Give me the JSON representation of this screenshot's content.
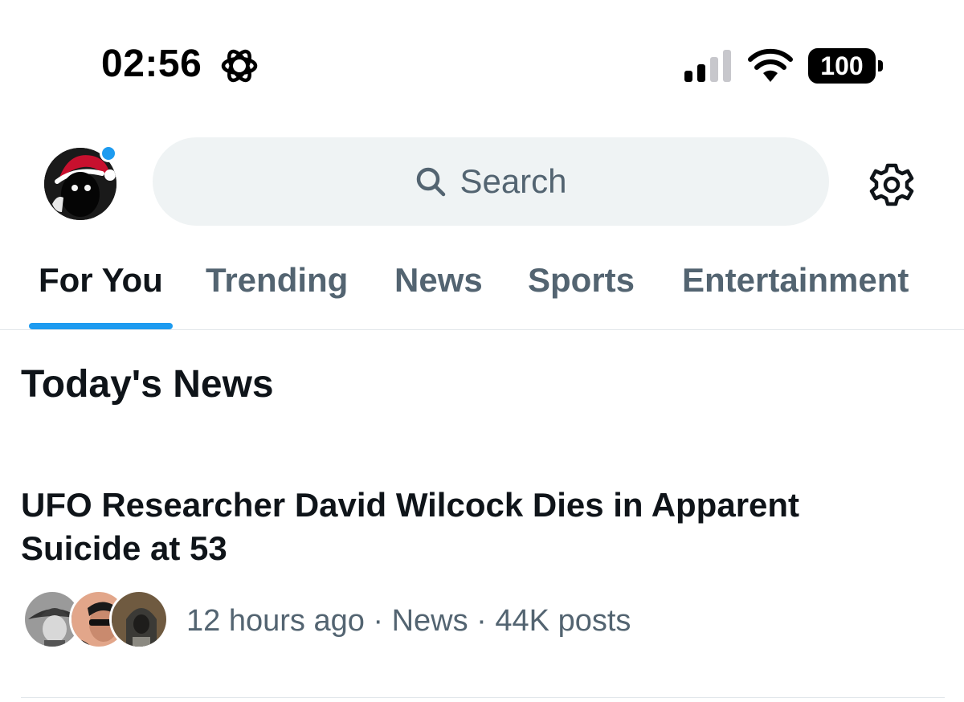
{
  "status_bar": {
    "time": "02:56",
    "status_icon": "gear-icon",
    "signal_icon": "cellular-signal-icon",
    "wifi_icon": "wifi-icon",
    "battery": "100"
  },
  "header": {
    "avatar_icon": "profile-avatar",
    "search_placeholder": "Search",
    "settings_icon": "gear-icon"
  },
  "tabs": [
    {
      "label": "For You",
      "active": true
    },
    {
      "label": "Trending",
      "active": false
    },
    {
      "label": "News",
      "active": false
    },
    {
      "label": "Sports",
      "active": false
    },
    {
      "label": "Entertainment",
      "active": false
    }
  ],
  "section": {
    "title": "Today's News"
  },
  "story": {
    "headline": "UFO Researcher David Wilcock Dies in Apparent Suicide at 53",
    "meta": "12 hours ago · News · 44K posts"
  },
  "colors": {
    "accent": "#1d9bf0",
    "text_primary": "#0f1419",
    "text_secondary": "#536471",
    "search_bg": "#eff3f4"
  }
}
